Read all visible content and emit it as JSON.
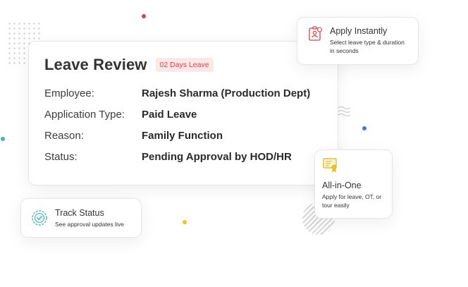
{
  "leave_review": {
    "title": "Leave Review",
    "badge": "02 Days Leave",
    "rows": [
      {
        "label": "Employee:",
        "value": "Rajesh Sharma (Production Dept)"
      },
      {
        "label": "Application Type:",
        "value": "Paid Leave"
      },
      {
        "label": "Reason:",
        "value": "Family Function"
      },
      {
        "label": "Status:",
        "value": "Pending Approval by HOD/HR"
      }
    ]
  },
  "apply_card": {
    "title": "Apply Instantly",
    "description": "Select leave type & duration in seconds",
    "icon": "document-user-icon"
  },
  "allinone_card": {
    "title": "All-in-One",
    "description": "Apply for leave, OT, or tour easily",
    "icon": "certificate-icon"
  },
  "track_card": {
    "title": "Track Status",
    "description": "See approval updates live",
    "icon": "badge-check-icon"
  },
  "colors": {
    "accent_red": "#d9434d",
    "badge_bg": "#fde8e8",
    "teal": "#46b3ad",
    "yellow": "#f2c41c",
    "blue": "#3d7be0"
  }
}
